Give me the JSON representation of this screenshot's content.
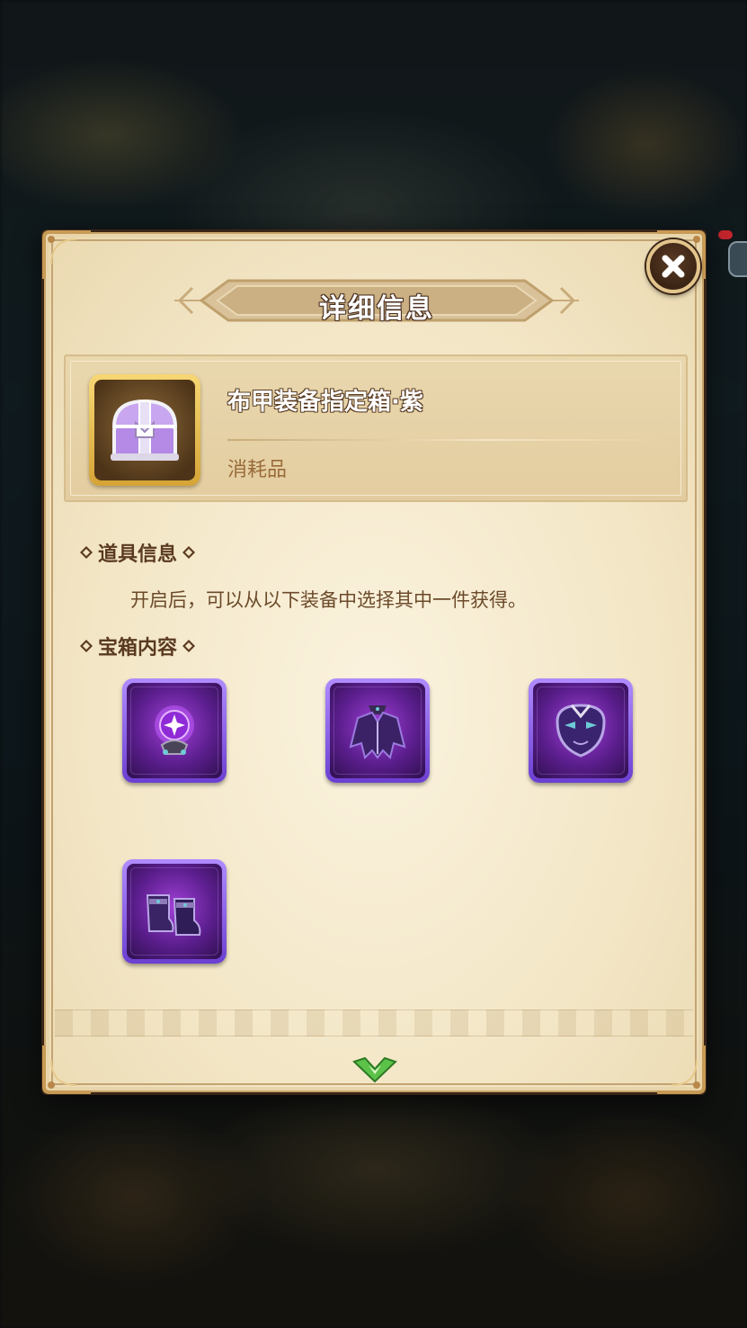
{
  "dialog": {
    "title": "详细信息",
    "close_icon": "close-icon"
  },
  "item": {
    "name": "布甲装备指定箱·紫",
    "type": "消耗品",
    "icon": "purple-treasure-chest-icon",
    "frame_color": "#f2c74f"
  },
  "sections": {
    "info_title": "道具信息",
    "info_text": "开启后，可以从以下装备中选择其中一件获得。",
    "contents_title": "宝箱内容"
  },
  "rewards": [
    {
      "icon": "purple-orb-icon"
    },
    {
      "icon": "purple-robe-icon"
    },
    {
      "icon": "purple-mask-icon"
    },
    {
      "icon": "purple-boots-icon"
    }
  ],
  "colors": {
    "rarity_purple": "#8a4de0",
    "accent_green": "#5cc24a",
    "parchment": "#f3e6c6"
  },
  "footer": {
    "scroll_icon": "chevron-down-icon"
  }
}
